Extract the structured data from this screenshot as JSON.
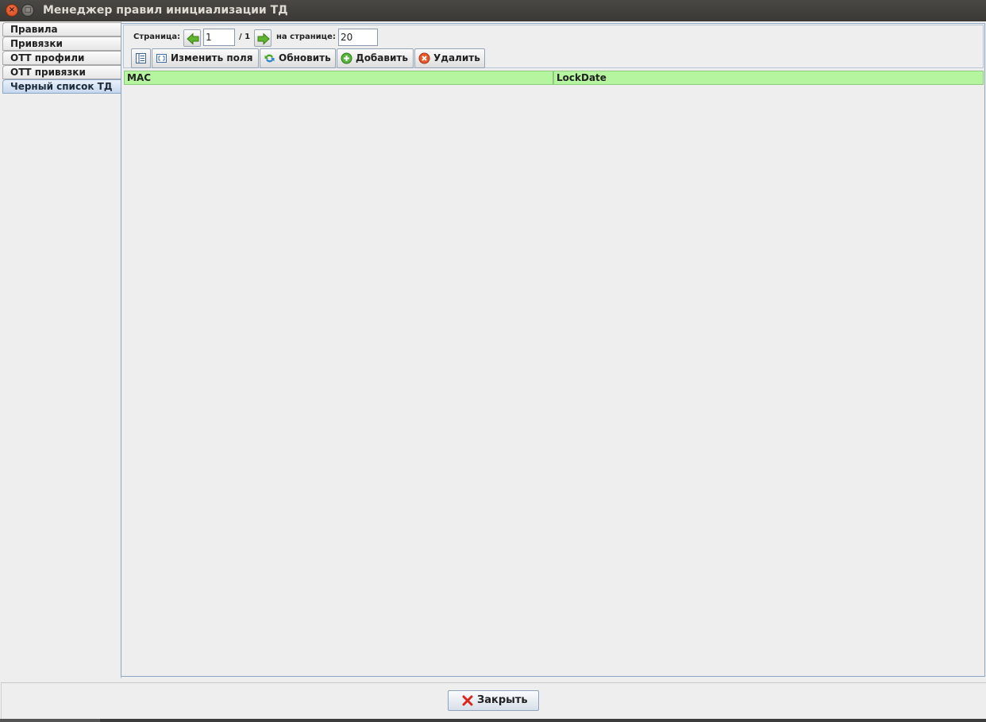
{
  "window": {
    "title": "Менеджер правил инициализации ТД"
  },
  "sidebar": {
    "tabs": [
      {
        "label": "Правила"
      },
      {
        "label": "Привязки"
      },
      {
        "label": "ОТТ профили"
      },
      {
        "label": "ОТТ привязки"
      },
      {
        "label": "Черный список ТД",
        "active": true
      }
    ]
  },
  "pager": {
    "page_label": "Страница:",
    "page_value": "1",
    "total_label": "/ 1",
    "per_page_label": "на странице:",
    "per_page_value": "20"
  },
  "toolbar": {
    "columns_icon": "table-columns-icon",
    "edit_fields": "Изменить поля",
    "refresh": "Обновить",
    "add": "Добавить",
    "delete": "Удалить"
  },
  "table": {
    "columns": [
      "MAC",
      "LockDate"
    ],
    "rows": []
  },
  "footer": {
    "close": "Закрыть"
  },
  "colors": {
    "header_bg": "#b5f5a0",
    "active_tab": "#c6d8ee",
    "titlebar": "#3c3b37"
  }
}
